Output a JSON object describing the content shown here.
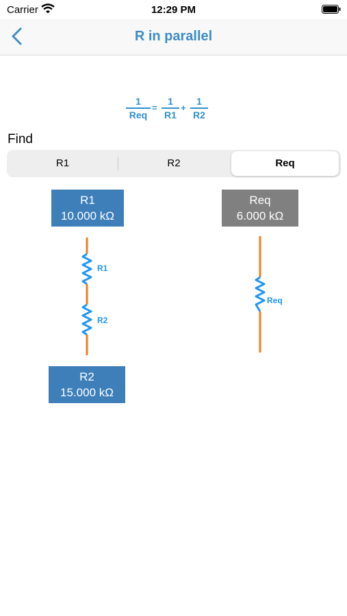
{
  "status_bar": {
    "carrier": "Carrier",
    "time": "12:29 PM"
  },
  "nav": {
    "title": "R in parallel"
  },
  "formula": {
    "numerator": "1",
    "lhs_den": "Req",
    "equals": "=",
    "plus": "+",
    "r1_den": "R1",
    "r2_den": "R2"
  },
  "find": {
    "label": "Find",
    "options": [
      "R1",
      "R2",
      "Req"
    ],
    "selected": "Req"
  },
  "r1": {
    "label": "R1",
    "value": "10.000 kΩ"
  },
  "r2": {
    "label": "R2",
    "value": "15.000 kΩ"
  },
  "req": {
    "label": "Req",
    "value": "6.000 kΩ"
  },
  "circuit": {
    "r1_label": "R1",
    "r2_label": "R2",
    "req_label": "Req"
  },
  "colors": {
    "accent": "#3c8dc6",
    "resistor": "#2196f3",
    "wire": "#f07f1f",
    "box_blue": "#3e7fba",
    "box_gray": "#808080"
  }
}
